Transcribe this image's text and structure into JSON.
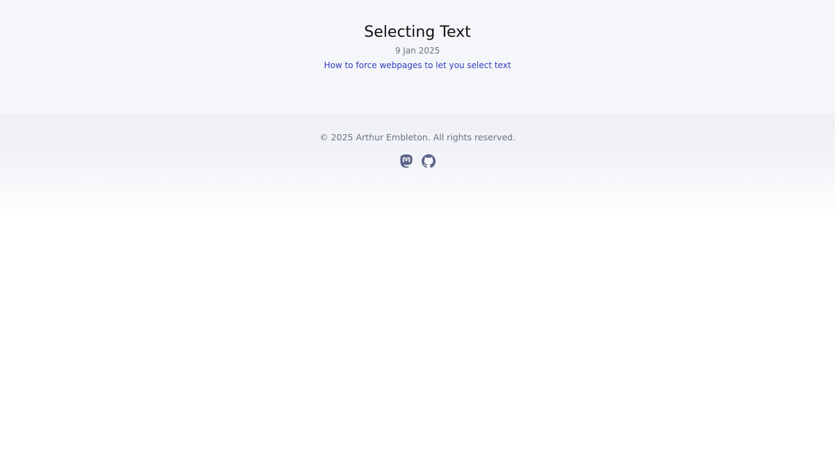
{
  "post": {
    "title": "Selecting Text",
    "date": "9 Jan 2025",
    "summary": "How to force webpages to let you select text"
  },
  "footer": {
    "copyright": "© 2025 Arthur Embleton. All rights reserved.",
    "social": [
      {
        "icon": "mastodon-icon"
      },
      {
        "icon": "github-icon"
      }
    ]
  },
  "colors": {
    "header_bg": "#f5f6f9",
    "link": "#2e3bbf",
    "muted_text": "#6a7082",
    "icon": "#5b6488",
    "title": "#111111"
  }
}
